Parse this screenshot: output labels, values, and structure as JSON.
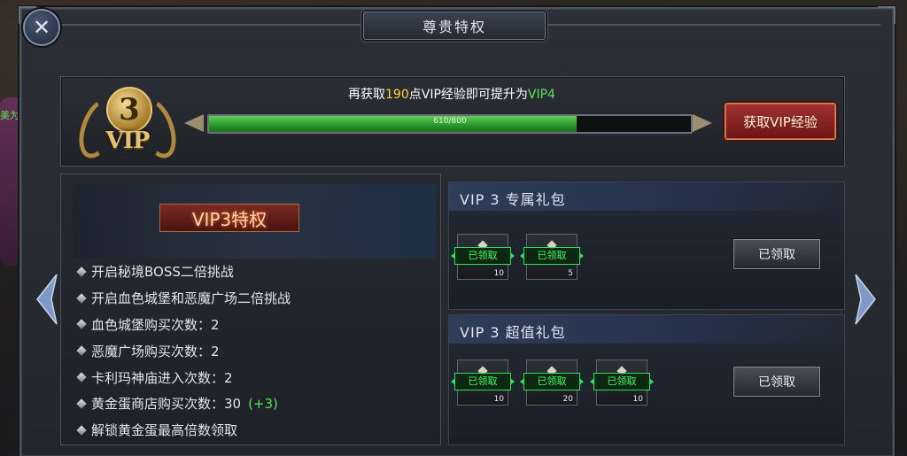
{
  "window": {
    "title": "尊贵特权"
  },
  "scene": {
    "label": "美为"
  },
  "vip": {
    "level": "3",
    "badge_word": "VIP",
    "upgrade": {
      "prefix": "再获取",
      "points": "190",
      "middle": "点VIP经验即可提升为",
      "next_level": "VIP4"
    },
    "progress": {
      "current": 610,
      "max": 800,
      "label": "610/800"
    },
    "get_exp_button": "获取VIP经验"
  },
  "privileges": {
    "title": "VIP3特权",
    "items": [
      {
        "text": "开启秘境BOSS二倍挑战",
        "bonus": ""
      },
      {
        "text": "开启血色城堡和恶魔广场二倍挑战",
        "bonus": ""
      },
      {
        "text": "血色城堡购买次数：2",
        "bonus": ""
      },
      {
        "text": "恶魔广场购买次数：2",
        "bonus": ""
      },
      {
        "text": "卡利玛神庙进入次数：2",
        "bonus": ""
      },
      {
        "text": "黄金蛋商店购买次数：30",
        "bonus": "(+3)"
      },
      {
        "text": "解锁黄金蛋最高倍数领取",
        "bonus": ""
      }
    ]
  },
  "gifts": [
    {
      "title": "VIP 3  专属礼包",
      "button": "已领取",
      "items": [
        {
          "status": "已领取",
          "count": "10"
        },
        {
          "status": "已领取",
          "count": "5"
        }
      ]
    },
    {
      "title": "VIP 3  超值礼包",
      "button": "已领取",
      "items": [
        {
          "status": "已领取",
          "count": "10"
        },
        {
          "status": "已领取",
          "count": "20"
        },
        {
          "status": "已领取",
          "count": "10"
        }
      ]
    }
  ],
  "colors": {
    "accent_yellow": "#ffd633",
    "accent_green": "#5ce25a",
    "button_red": "#a23232"
  },
  "icons": {
    "close": "close-icon",
    "prev": "chevron-left-icon",
    "next": "chevron-right-icon"
  }
}
